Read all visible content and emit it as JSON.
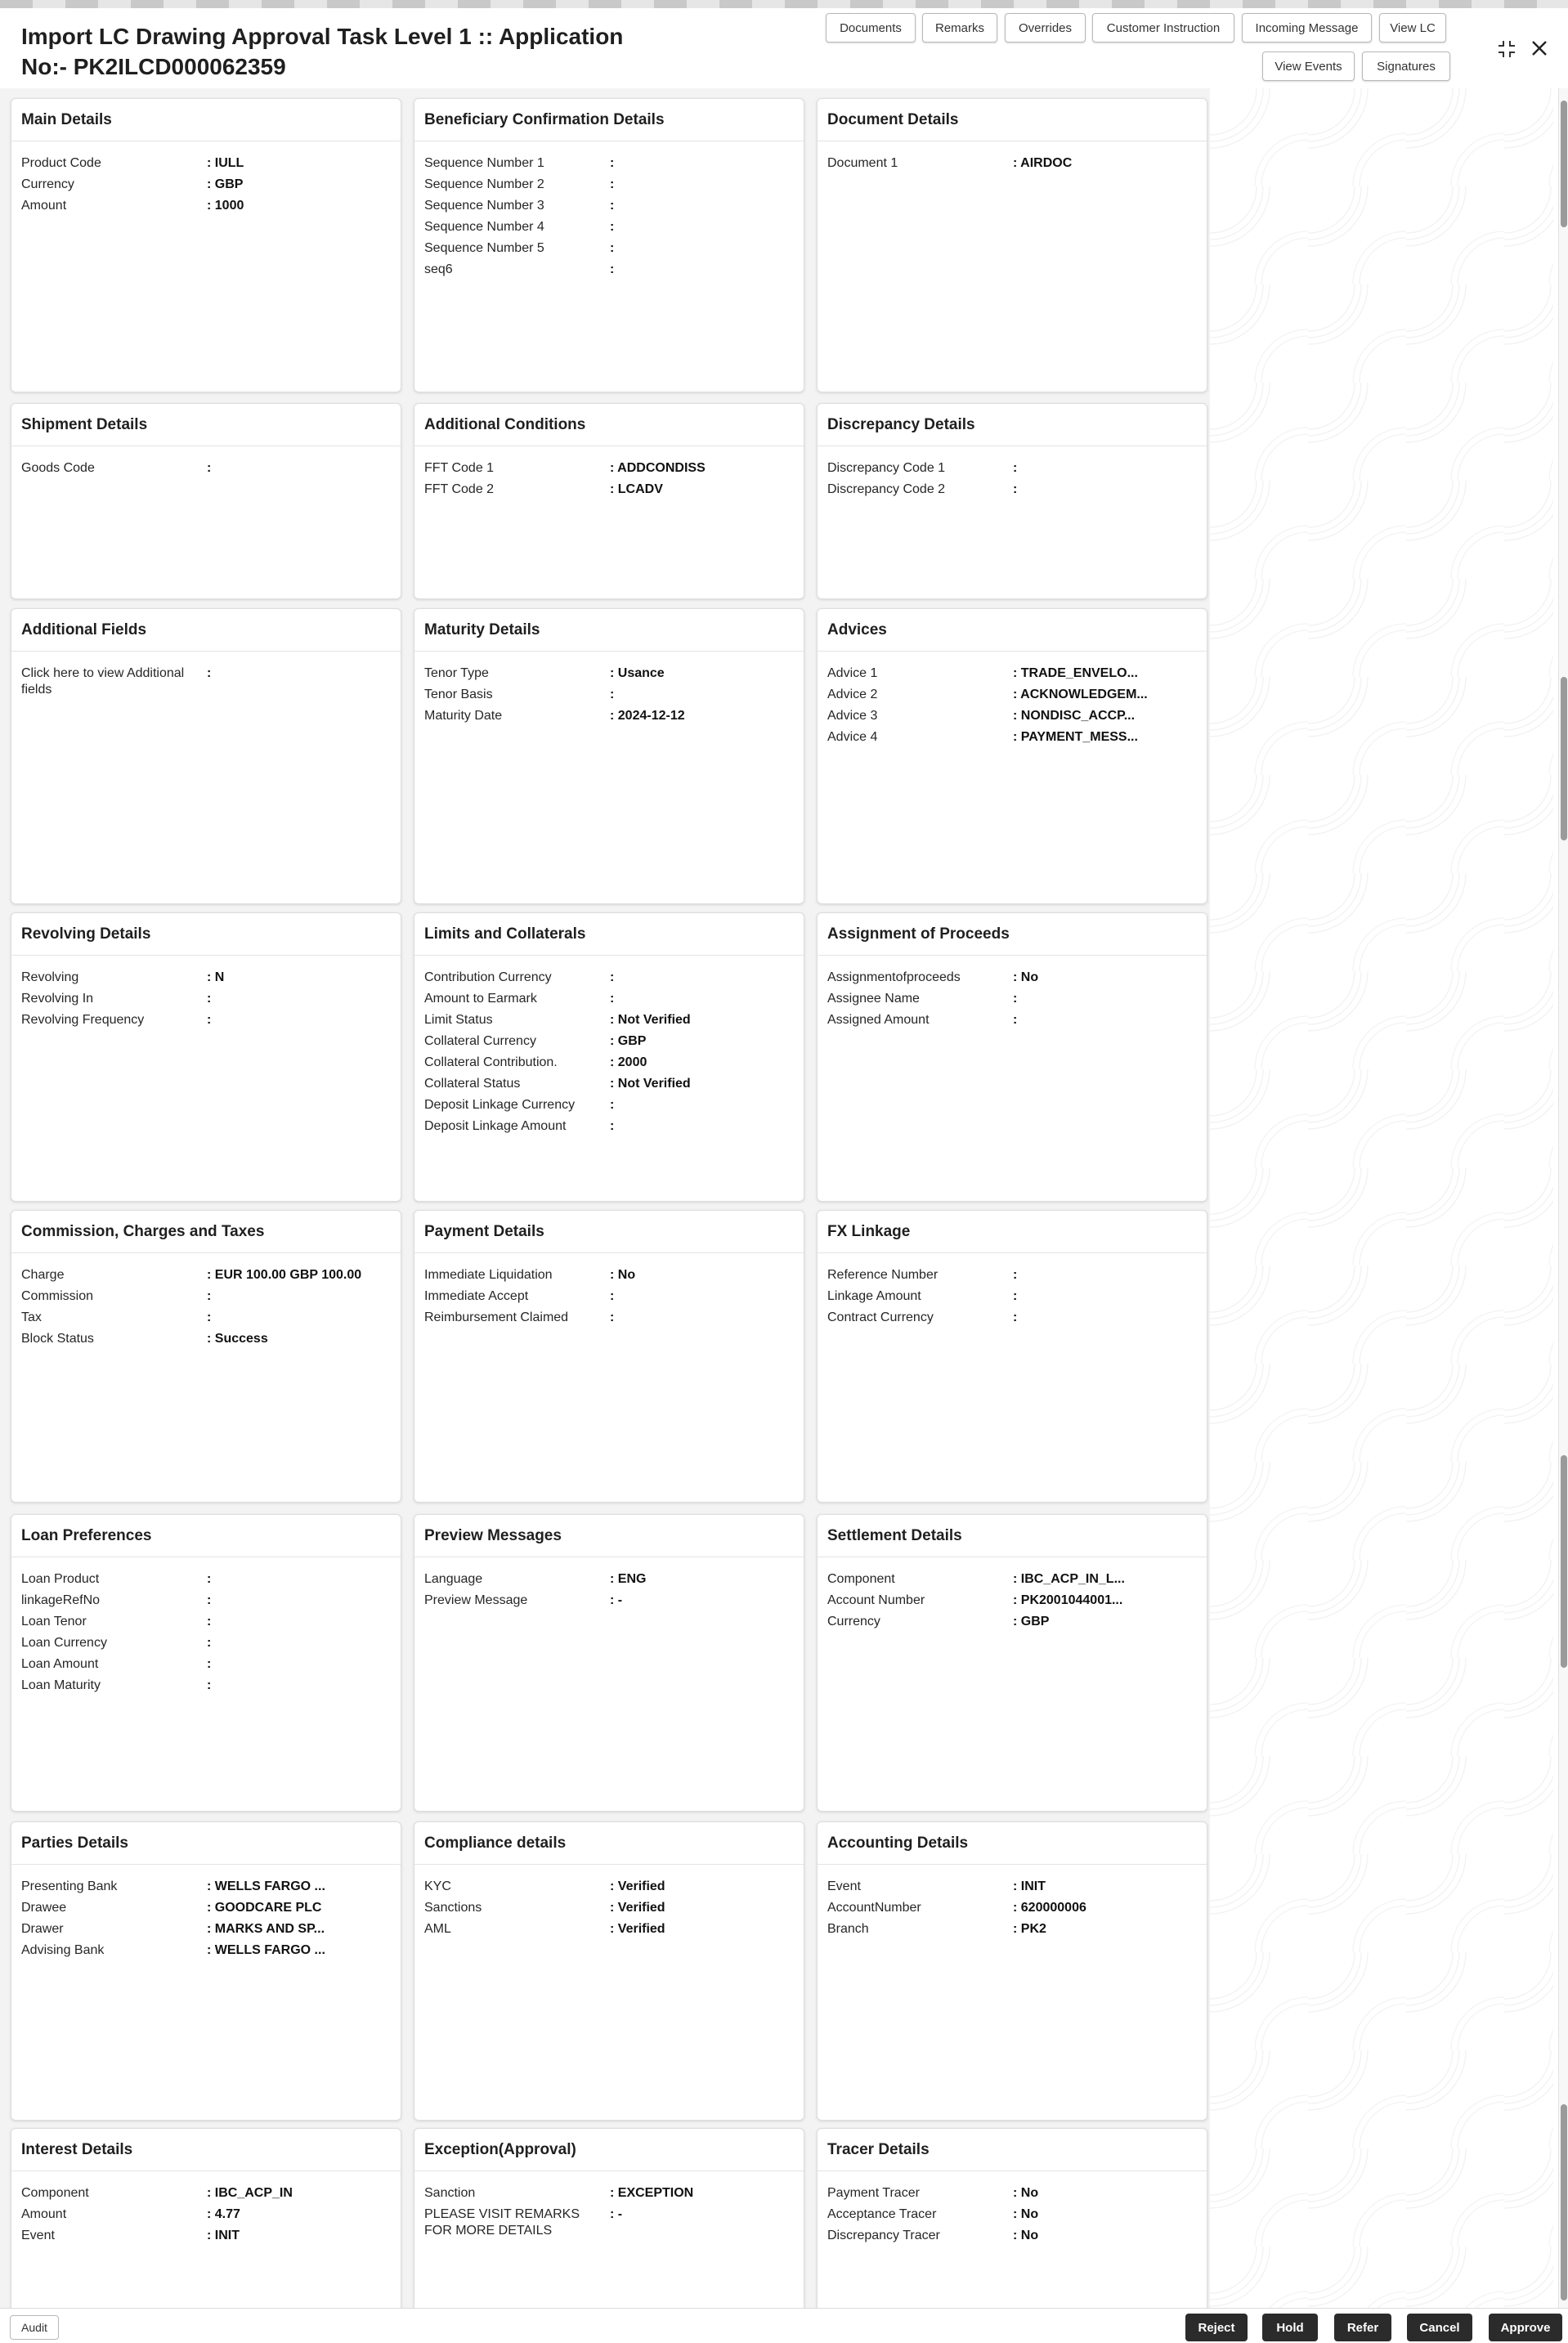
{
  "header": {
    "title": "Import LC Drawing Approval Task Level 1 :: Application No:- PK2ILCD000062359",
    "buttons": {
      "documents": "Documents",
      "remarks": "Remarks",
      "overrides": "Overrides",
      "customer_instruction": "Customer Instruction",
      "incoming_message": "Incoming Message",
      "view_lc": "View LC",
      "view_events": "View Events",
      "signatures": "Signatures"
    },
    "icons": {
      "collapse": "collapse-icon",
      "close": "close-icon"
    }
  },
  "cards": [
    {
      "title": "Main Details",
      "rows": [
        {
          "label": "Product Code",
          "value": ": IULL"
        },
        {
          "label": "Currency",
          "value": ": GBP"
        },
        {
          "label": "Amount",
          "value": ": 1000"
        }
      ]
    },
    {
      "title": "Beneficiary Confirmation Details",
      "rows": [
        {
          "label": "Sequence Number 1",
          "value": ":"
        },
        {
          "label": "Sequence Number 2",
          "value": ":"
        },
        {
          "label": "Sequence Number 3",
          "value": ":"
        },
        {
          "label": "Sequence Number 4",
          "value": ":"
        },
        {
          "label": "Sequence Number 5",
          "value": ":"
        },
        {
          "label": "seq6",
          "value": ":"
        }
      ]
    },
    {
      "title": "Document Details",
      "rows": [
        {
          "label": "Document 1",
          "value": ": AIRDOC"
        }
      ]
    },
    {
      "title": "Shipment Details",
      "rows": [
        {
          "label": "Goods Code",
          "value": ":"
        }
      ]
    },
    {
      "title": "Additional Conditions",
      "rows": [
        {
          "label": "FFT Code 1",
          "value": ": ADDCONDISS"
        },
        {
          "label": "FFT Code 2",
          "value": ": LCADV"
        }
      ]
    },
    {
      "title": "Discrepancy Details",
      "rows": [
        {
          "label": "Discrepancy Code 1",
          "value": ":"
        },
        {
          "label": "Discrepancy Code 2",
          "value": ":"
        }
      ]
    },
    {
      "title": "Additional Fields",
      "rows": [
        {
          "label": "Click here to view Additional fields",
          "value": ":"
        }
      ]
    },
    {
      "title": "Maturity Details",
      "rows": [
        {
          "label": "Tenor Type",
          "value": ": Usance"
        },
        {
          "label": "Tenor Basis",
          "value": ":"
        },
        {
          "label": "Maturity Date",
          "value": ": 2024-12-12"
        }
      ]
    },
    {
      "title": "Advices",
      "rows": [
        {
          "label": "Advice 1",
          "value": ": TRADE_ENVELO..."
        },
        {
          "label": "Advice 2",
          "value": ": ACKNOWLEDGEM..."
        },
        {
          "label": "Advice 3",
          "value": ": NONDISC_ACCP..."
        },
        {
          "label": "Advice 4",
          "value": ": PAYMENT_MESS..."
        }
      ]
    },
    {
      "title": "Revolving Details",
      "rows": [
        {
          "label": "Revolving",
          "value": ": N"
        },
        {
          "label": "Revolving In",
          "value": ":"
        },
        {
          "label": "Revolving Frequency",
          "value": ":"
        }
      ]
    },
    {
      "title": "Limits and Collaterals",
      "rows": [
        {
          "label": "Contribution Currency",
          "value": ":"
        },
        {
          "label": "Amount to Earmark",
          "value": ":"
        },
        {
          "label": "Limit Status",
          "value": ": Not Verified"
        },
        {
          "label": "Collateral Currency",
          "value": ": GBP"
        },
        {
          "label": "Collateral Contribution.",
          "value": ": 2000"
        },
        {
          "label": "Collateral Status",
          "value": ": Not Verified"
        },
        {
          "label": "Deposit Linkage Currency",
          "value": ":"
        },
        {
          "label": "Deposit Linkage Amount",
          "value": ":"
        }
      ]
    },
    {
      "title": "Assignment of Proceeds",
      "rows": [
        {
          "label": "Assignmentofproceeds",
          "value": ": No"
        },
        {
          "label": "Assignee Name",
          "value": ":"
        },
        {
          "label": "Assigned Amount",
          "value": ":"
        }
      ]
    },
    {
      "title": "Commission, Charges and Taxes",
      "rows": [
        {
          "label": "Charge",
          "value": ": EUR  100.00 GBP  100.00"
        },
        {
          "label": "Commission",
          "value": ":"
        },
        {
          "label": "Tax",
          "value": ":"
        },
        {
          "label": "Block Status",
          "value": ": Success"
        }
      ]
    },
    {
      "title": "Payment Details",
      "rows": [
        {
          "label": "Immediate Liquidation",
          "value": ": No"
        },
        {
          "label": "Immediate Accept",
          "value": ":"
        },
        {
          "label": "Reimbursement Claimed",
          "value": ":"
        }
      ]
    },
    {
      "title": "FX Linkage",
      "rows": [
        {
          "label": "Reference Number",
          "value": ":"
        },
        {
          "label": "Linkage Amount",
          "value": ":"
        },
        {
          "label": "Contract Currency",
          "value": ":"
        }
      ]
    },
    {
      "title": "Loan Preferences",
      "rows": [
        {
          "label": "Loan Product",
          "value": ":"
        },
        {
          "label": "linkageRefNo",
          "value": ":"
        },
        {
          "label": "Loan Tenor",
          "value": ":"
        },
        {
          "label": "Loan Currency",
          "value": ":"
        },
        {
          "label": "Loan Amount",
          "value": ":"
        },
        {
          "label": "Loan Maturity",
          "value": ":"
        }
      ]
    },
    {
      "title": "Preview Messages",
      "rows": [
        {
          "label": "Language",
          "value": ": ENG"
        },
        {
          "label": "Preview Message",
          "value": ": -"
        }
      ]
    },
    {
      "title": "Settlement Details",
      "rows": [
        {
          "label": "Component",
          "value": ": IBC_ACP_IN_L..."
        },
        {
          "label": "Account Number",
          "value": ": PK2001044001..."
        },
        {
          "label": "Currency",
          "value": ": GBP"
        }
      ]
    },
    {
      "title": "Parties Details",
      "rows": [
        {
          "label": "Presenting Bank",
          "value": ": WELLS FARGO ..."
        },
        {
          "label": "Drawee",
          "value": ": GOODCARE PLC"
        },
        {
          "label": "Drawer",
          "value": ": MARKS AND SP..."
        },
        {
          "label": "Advising Bank",
          "value": ": WELLS FARGO ..."
        }
      ]
    },
    {
      "title": "Compliance details",
      "rows": [
        {
          "label": "KYC",
          "value": ": Verified"
        },
        {
          "label": "Sanctions",
          "value": ": Verified"
        },
        {
          "label": "AML",
          "value": ": Verified"
        }
      ]
    },
    {
      "title": "Accounting Details",
      "rows": [
        {
          "label": "Event",
          "value": ": INIT"
        },
        {
          "label": "AccountNumber",
          "value": ": 620000006"
        },
        {
          "label": "Branch",
          "value": ": PK2"
        }
      ]
    },
    {
      "title": "Interest Details",
      "rows": [
        {
          "label": "Component",
          "value": ": IBC_ACP_IN"
        },
        {
          "label": "Amount",
          "value": ": 4.77"
        },
        {
          "label": "Event",
          "value": ": INIT"
        }
      ]
    },
    {
      "title": "Exception(Approval)",
      "rows": [
        {
          "label": "Sanction",
          "value": ": EXCEPTION"
        },
        {
          "label": "PLEASE VISIT REMARKS FOR MORE DETAILS",
          "value": ": -"
        }
      ]
    },
    {
      "title": "Tracer Details",
      "rows": [
        {
          "label": "Payment Tracer",
          "value": ": No"
        },
        {
          "label": "Acceptance Tracer",
          "value": ": No"
        },
        {
          "label": "Discrepancy Tracer",
          "value": ": No"
        }
      ]
    }
  ],
  "footer": {
    "audit": "Audit",
    "reject": "Reject",
    "hold": "Hold",
    "refer": "Refer",
    "cancel": "Cancel",
    "approve": "Approve"
  }
}
